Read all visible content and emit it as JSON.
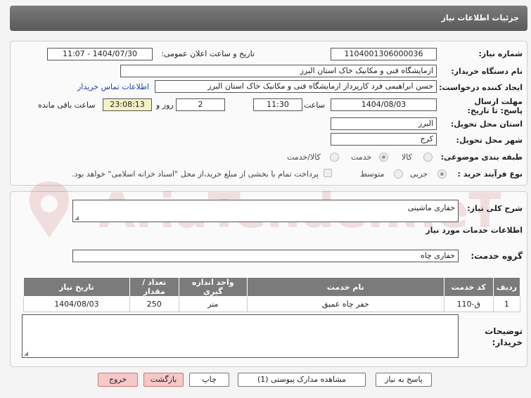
{
  "header": {
    "title": "جزئیات اطلاعات نیاز"
  },
  "form": {
    "need_number_label": "شماره نیاز:",
    "need_number": "1104001306000036",
    "announce_label": "تاریخ و ساعت اعلان عمومی:",
    "announce_value": "1404/07/30 - 11:07",
    "buyer_org_label": "نام دستگاه خریدار:",
    "buyer_org": "ازمایشگاه فنی و مکانیک خاک استان البرز",
    "creator_label": "ایجاد کننده درخواست:",
    "creator": "حسن ابراهیمی فرد کارپرداز ازمایشگاه فنی و مکانیک خاک استان البرز",
    "contact_link": "اطلاعات تماس خریدار",
    "deadline_label": "مهلت ارسال پاسخ: تا تاریخ:",
    "deadline_date": "1404/08/03",
    "time_label": "ساعت",
    "deadline_time": "11:30",
    "days": "2",
    "days_label": "روز و",
    "remaining_time": "23:08:13",
    "remaining_label": "ساعت باقی مانده",
    "province_label": "استان محل تحویل:",
    "province": "البرز",
    "city_label": "شهر محل تحویل:",
    "city": "کرج",
    "category_label": "طبقه بندی موضوعی:",
    "category_options": [
      "کالا",
      "خدمت",
      "کالا/خدمت"
    ],
    "process_label": "نوع فرآیند خرید :",
    "process_options": [
      "جزیی",
      "متوسط"
    ],
    "payment_note": "پرداخت تمام یا بخشی از مبلغ خرید،از محل \"اسناد خزانه اسلامی\" خواهد بود."
  },
  "details": {
    "description_label": "شرح کلی نیاز:",
    "description": "حفاری ماشینی",
    "services_heading": "اطلاعات خدمات مورد نیاز",
    "service_group_label": "گروه خدمت:",
    "service_group": "حفاری چاه",
    "table": {
      "headers": [
        "ردیف",
        "کد خدمت",
        "نام خدمت",
        "واحد اندازه گیری",
        "تعداد / مقدار",
        "تاریخ نیاز"
      ],
      "rows": [
        [
          "1",
          "ق-110",
          "حفر چاه عمیق",
          "متر",
          "250",
          "1404/08/03"
        ]
      ]
    },
    "buyer_notes_label": "توضیحات خریدار:"
  },
  "buttons": {
    "reply": "پاسخ به نیاز",
    "attachments": "مشاهده مدارک پیوستی (1)",
    "print": "چاپ",
    "back": "بازگشت",
    "exit": "خروج"
  },
  "watermark": {
    "text": "AriaTender.neT"
  },
  "colors": {
    "header": "#6a6a6a",
    "table_header": "#7b7b7b",
    "remaining_bg": "#f4f2c2",
    "exit_bg": "#f6c8c8",
    "link": "#1a3fb0"
  }
}
